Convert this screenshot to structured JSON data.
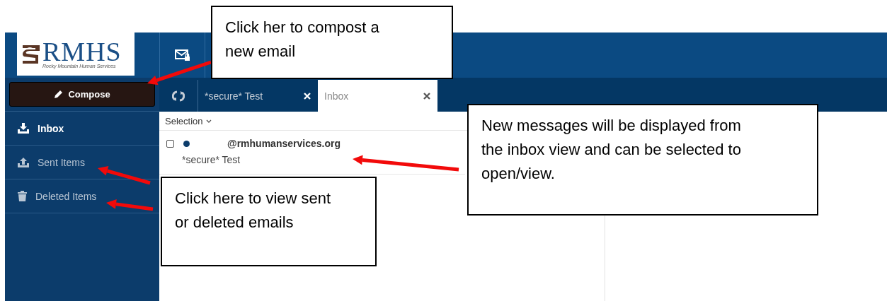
{
  "header": {
    "logo": {
      "name": "RMHS",
      "tagline": "Rocky Mountain Human Services"
    }
  },
  "sidebar": {
    "compose": "Compose",
    "items": [
      {
        "label": "Inbox",
        "kind": "inbox",
        "selected": true
      },
      {
        "label": "Sent Items",
        "kind": "sent",
        "selected": false
      },
      {
        "label": "Deleted Items",
        "kind": "deleted",
        "selected": false
      }
    ]
  },
  "tabs": [
    {
      "label": "*secure* Test",
      "selected": false
    },
    {
      "label": "Inbox",
      "selected": true
    }
  ],
  "list": {
    "selection": "Selection",
    "messages": [
      {
        "sender": "@rmhumanservices.org",
        "subject": "*secure* Test",
        "checked": false,
        "unread": true
      }
    ]
  },
  "callouts": [
    {
      "lines": [
        "Click her to compost a",
        "new email"
      ]
    },
    {
      "lines": [
        "New messages will be displayed from",
        "the inbox view and can be selected to",
        "open/view."
      ]
    },
    {
      "lines": [
        "Click here to view sent",
        "or deleted emails"
      ]
    }
  ]
}
